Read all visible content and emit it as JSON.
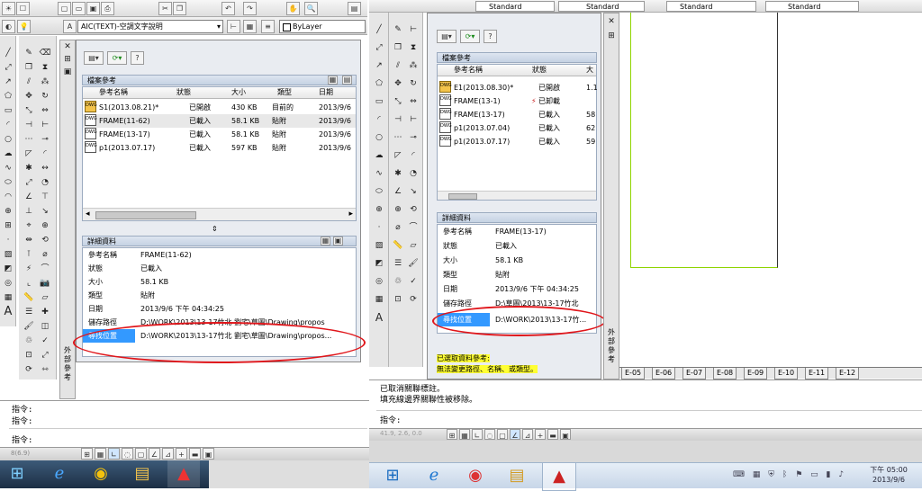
{
  "left": {
    "style_value": "AIC(TEXT)-空調文字說明",
    "layer_value": "ByLayer",
    "panel_title": "檔案參考",
    "columns": [
      "參考名稱",
      "狀態",
      "大小",
      "類型",
      "日期"
    ],
    "refs": [
      {
        "name": "S1(2013.08.21)*",
        "status": "已開啟",
        "size": "430 KB",
        "type": "目前的",
        "date": "2013/9/6",
        "icon": "image-file-icon"
      },
      {
        "name": "FRAME(11-62)",
        "status": "已載入",
        "size": "58.1 KB",
        "type": "貼附",
        "date": "2013/9/6",
        "icon": "dwg-file-icon"
      },
      {
        "name": "FRAME(13-17)",
        "status": "已載入",
        "size": "58.1 KB",
        "type": "貼附",
        "date": "2013/9/6",
        "icon": "dwg-file-icon"
      },
      {
        "name": "p1(2013.07.17)",
        "status": "已載入",
        "size": "597 KB",
        "type": "貼附",
        "date": "2013/9/6",
        "icon": "dwg-file-icon"
      }
    ],
    "details_title": "詳細資料",
    "details": [
      {
        "k": "參考名稱",
        "v": "FRAME(11-62)"
      },
      {
        "k": "狀態",
        "v": "已載入"
      },
      {
        "k": "大小",
        "v": "58.1 KB"
      },
      {
        "k": "類型",
        "v": "貼附"
      },
      {
        "k": "日期",
        "v": "2013/9/6 下午 04:34:25"
      },
      {
        "k": "儲存路徑",
        "v": "D:\\WORK\\2013\\13-17竹北 劉宅\\草圖\\Drawing\\propos"
      },
      {
        "k": "尋找位置",
        "v": "D:\\WORK\\2013\\13-17竹北 劉宅\\草圖\\Drawing\\propos..."
      }
    ],
    "side_label": "外部參考",
    "cmd_lines": [
      "指令:",
      "指令:"
    ],
    "cmd_prompt": "指令:",
    "status_text": "8(6.9)"
  },
  "right": {
    "toolbar_values": [
      "Standard",
      "Standard",
      "Standard",
      "Standard"
    ],
    "panel_title": "檔案參考",
    "columns": [
      "參考名稱",
      "狀態",
      "大"
    ],
    "refs": [
      {
        "name": "E1(2013.08.30)*",
        "status": "已開啟",
        "size": "1.1",
        "icon": "image-file-icon"
      },
      {
        "name": "FRAME(13-1)",
        "status": "已卸載",
        "size": "",
        "icon": "dwg-file-icon"
      },
      {
        "name": "FRAME(13-17)",
        "status": "已載入",
        "size": "58",
        "icon": "dwg-file-icon"
      },
      {
        "name": "p1(2013.07.04)",
        "status": "已載入",
        "size": "62",
        "icon": "dwg-file-icon"
      },
      {
        "name": "p1(2013.07.17)",
        "status": "已載入",
        "size": "59",
        "icon": "dwg-file-icon"
      }
    ],
    "details_title": "詳細資料",
    "details": [
      {
        "k": "參考名稱",
        "v": "FRAME(13-17)"
      },
      {
        "k": "狀態",
        "v": "已載入"
      },
      {
        "k": "大小",
        "v": "58.1 KB"
      },
      {
        "k": "類型",
        "v": "貼附"
      },
      {
        "k": "日期",
        "v": "2013/9/6 下午 04:34:25"
      },
      {
        "k": "儲存路徑",
        "v": "D:\\草圖\\2013\\13-17竹北"
      },
      {
        "k": "尋找位置",
        "v": "D:\\WORK\\2013\\13-17竹..."
      }
    ],
    "notice_line1": "已選取資料參考:",
    "notice_line2": "無法變更路徑、名稱、或類型。",
    "side_label": "外部參考",
    "layout_tabs": [
      "E-05",
      "E-06",
      "E-07",
      "E-08",
      "E-09",
      "E-10",
      "E-11",
      "E-12"
    ],
    "cmd_lines": [
      "已取消關聯標註。",
      "填充線邊界關聯性被移除。"
    ],
    "cmd_prompt": "指令:",
    "status_text": "41.9, 2.6, 0.0",
    "clock_time": "下午 05:00",
    "clock_date": "2013/9/6"
  },
  "colors": {
    "highlight": "#3399ff",
    "annotation": "#e0161b",
    "notice": "#ffff33",
    "drawing_bg": "#ffffff"
  }
}
